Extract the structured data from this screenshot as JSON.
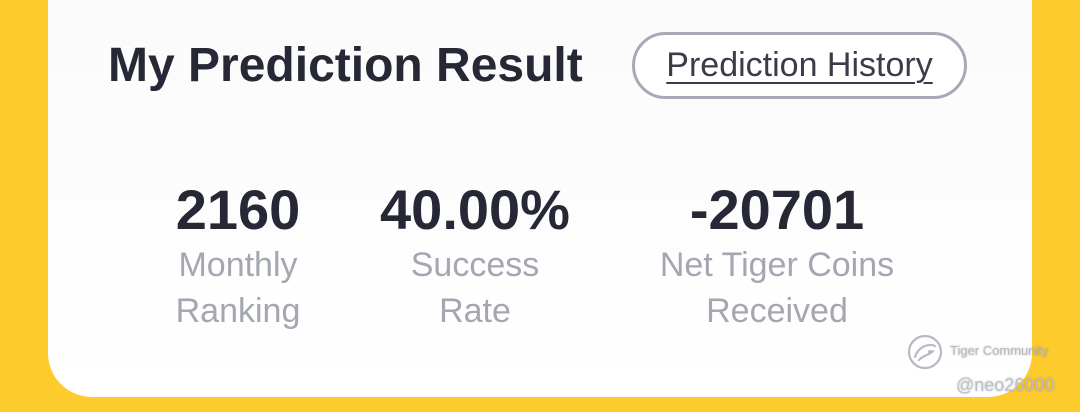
{
  "header": {
    "title": "My Prediction Result",
    "history_button_label": "Prediction History"
  },
  "stats": [
    {
      "value": "2160",
      "label_line1": "Monthly",
      "label_line2": "Ranking"
    },
    {
      "value": "40.00%",
      "label_line1": "Success",
      "label_line2": "Rate"
    },
    {
      "value": "-20701",
      "label_line1": "Net Tiger Coins",
      "label_line2": "Received"
    }
  ],
  "watermark": {
    "brand": "Tiger Community",
    "user": "@neo26000",
    "icon": "tiger-community-logo-icon"
  },
  "colors": {
    "background_accent": "#FDCB2C",
    "card_background": "#FFFFFF",
    "primary_text": "#262836",
    "secondary_text": "#A4A7B2",
    "button_border": "#A7AAB6"
  }
}
